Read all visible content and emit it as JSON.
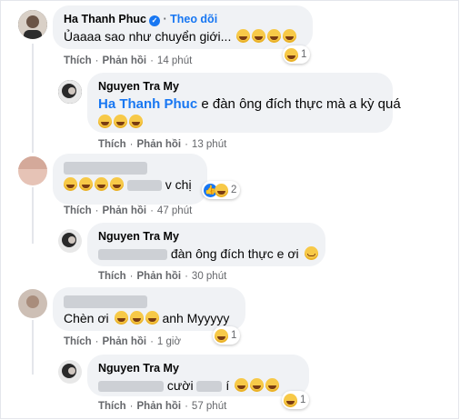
{
  "comments": [
    {
      "author": "Ha Thanh Phuc",
      "verified": true,
      "follow_label": "Theo dõi",
      "text": "Ủaaaa sao như chuyển giới...",
      "emoji_count": 4,
      "reaction_count": "1",
      "like_label": "Thích",
      "reply_label": "Phản hồi",
      "time": "14 phút"
    },
    {
      "author": "Nguyen Tra My",
      "mention": "Ha Thanh Phuc",
      "text": "e đàn ông đích thực mà a kỳ quá",
      "emoji_count": 3,
      "like_label": "Thích",
      "reply_label": "Phản hồi",
      "time": "13 phút"
    },
    {
      "author": "",
      "text": "v chị",
      "emoji_count": 4,
      "reaction_count": "2",
      "like_label": "Thích",
      "reply_label": "Phản hồi",
      "time": "47 phút"
    },
    {
      "author": "Nguyen Tra My",
      "text": "đàn ông đích thực e ơi",
      "like_label": "Thích",
      "reply_label": "Phản hồi",
      "time": "30 phút"
    },
    {
      "author": "",
      "text": "Chèn ơi",
      "text_after": "anh Myyyyy",
      "emoji_count": 3,
      "reaction_count": "1",
      "like_label": "Thích",
      "reply_label": "Phản hồi",
      "time": "1 giờ"
    },
    {
      "author": "Nguyen Tra My",
      "text": "cười",
      "text_after": "í",
      "emoji_count": 3,
      "reaction_count": "1",
      "like_label": "Thích",
      "reply_label": "Phản hồi",
      "time": "57 phút"
    }
  ],
  "colors": {
    "bubble": "#f0f2f5",
    "link": "#1877f2",
    "meta": "#65676b"
  }
}
